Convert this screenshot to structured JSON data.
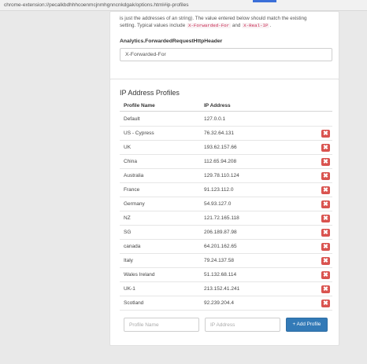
{
  "browser": {
    "url": "chrome-extension://pecalkbdhhhcoenmcjnmhgnncnkdgak/options.html#ip-profiles"
  },
  "forwarded_header": {
    "desc_prefix": "is just the addresses of an string). The value entered below should match the existing",
    "desc_middle": "setting. Typical values include",
    "code1": "X-Forwarded-For",
    "and_word": "and",
    "code2": "X-Real-IP",
    "desc_suffix": ".",
    "label": "Analytics.ForwardedRequestHttpHeader",
    "value": "X-Forwarded-For"
  },
  "profiles": {
    "title": "IP Address Profiles",
    "col_name": "Profile Name",
    "col_ip": "IP Address",
    "rows": [
      {
        "name": "Default",
        "ip": "127.0.0.1"
      },
      {
        "name": "US - Cypress",
        "ip": "76.32.64.131"
      },
      {
        "name": "UK",
        "ip": "193.62.157.66"
      },
      {
        "name": "China",
        "ip": "112.65.94.208"
      },
      {
        "name": "Australia",
        "ip": "129.78.110.124"
      },
      {
        "name": "France",
        "ip": "91.123.112.0"
      },
      {
        "name": "Germany",
        "ip": "54.93.127.0"
      },
      {
        "name": "NZ",
        "ip": "121.72.165.118"
      },
      {
        "name": "SG",
        "ip": "206.189.87.98"
      },
      {
        "name": "canada",
        "ip": "64.201.162.65"
      },
      {
        "name": "Italy",
        "ip": "79.24.137.58"
      },
      {
        "name": "Wales Ireland",
        "ip": "51.132.68.114"
      },
      {
        "name": "UK-1",
        "ip": "213.152.41.241"
      },
      {
        "name": "Scotland",
        "ip": "92.239.204.4"
      }
    ],
    "delete_glyph": "✖",
    "name_placeholder": "Profile Name",
    "ip_placeholder": "IP Address",
    "add_label": "+ Add Profile"
  },
  "colors": {
    "delete": "#d9534f",
    "primary": "#337ab7",
    "code": "#c7254e"
  }
}
